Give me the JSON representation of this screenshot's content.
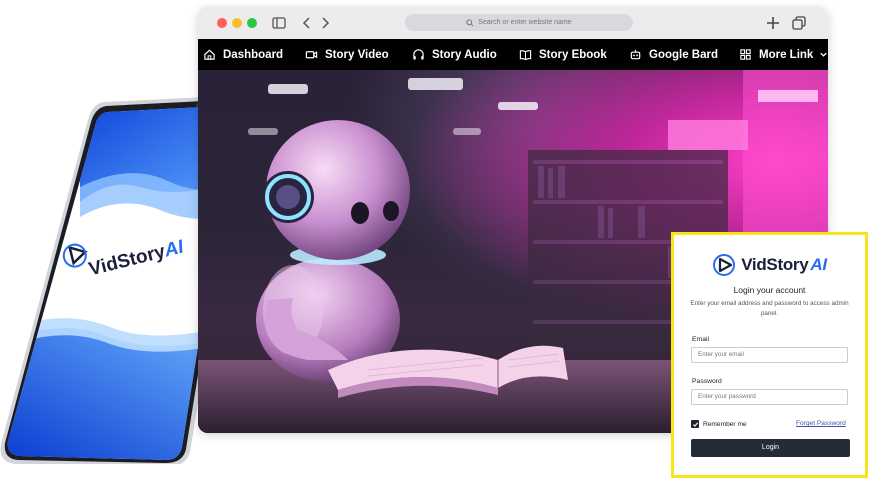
{
  "browser": {
    "address_placeholder": "Search or enter website name",
    "nav": [
      {
        "label": "Dashboard",
        "icon": "home-icon"
      },
      {
        "label": "Story Video",
        "icon": "video-camera-icon"
      },
      {
        "label": "Story Audio",
        "icon": "headphones-icon"
      },
      {
        "label": "Story Ebook",
        "icon": "open-book-icon"
      },
      {
        "label": "Google Bard",
        "icon": "robot-icon"
      },
      {
        "label": "More Link",
        "icon": "grid-icon"
      }
    ]
  },
  "phone": {
    "logo_main": "VidStory",
    "logo_accent": "AI"
  },
  "login": {
    "logo_main": "VidStory",
    "logo_accent": "AI",
    "title": "Login your account",
    "subtitle": "Enter your email address and password to access admin panel.",
    "email_label": "Email",
    "email_placeholder": "Enter your email",
    "password_label": "Password",
    "password_placeholder": "Enter your password",
    "remember_label": "Remember me",
    "forget_link": "Forget Password",
    "button_label": "Login"
  },
  "colors": {
    "accent_blue": "#2a6cf0",
    "navbar_bg": "#000000",
    "highlight_border": "#f8e51c",
    "hero_pink": "#ff3fc7"
  }
}
